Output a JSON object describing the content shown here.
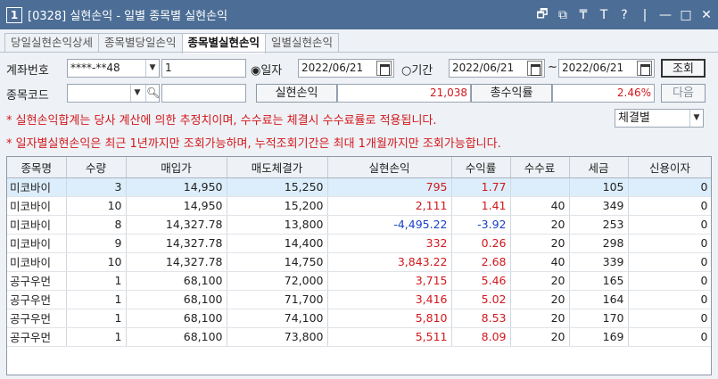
{
  "window": {
    "number": "1",
    "title": "[0328] 실현손익 - 일별 종목별 실현손익",
    "controls": [
      "🗗",
      "⧉",
      "₸",
      "T",
      "?",
      "|",
      "—",
      "□",
      "✕"
    ]
  },
  "tabs": [
    "당일실현손익상세",
    "종목별당일손익",
    "종목별실현손익",
    "일별실현손익"
  ],
  "active_tab": 2,
  "form": {
    "account_label": "계좌번호",
    "account_value": "****-**48",
    "account_sub": "1",
    "radio_date_label": "◉일자",
    "radio_range_label": "○기간",
    "date_value": "2022/06/21",
    "range_start": "2022/06/21",
    "range_sep": "~",
    "range_end": "2022/06/21",
    "query_button": "조회",
    "code_label": "종목코드",
    "code_value": "",
    "realized_label": "실현손익",
    "realized_value": "21,038",
    "total_rate_label": "총수익률",
    "total_rate_value": "2.46%",
    "next_button": "다음",
    "filter_value": "체결별"
  },
  "notes": [
    "* 실현손익합계는 당사 계산에 의한 추정치이며, 수수료는 체결시 수수료률로 적용됩니다.",
    "* 일자별실현손익은 최근 1년까지만 조회가능하며, 누적조회기간은 최대 1개월까지만 조회가능합니다."
  ],
  "table": {
    "headers": [
      "종목명",
      "수량",
      "매입가",
      "매도체결가",
      "실현손익",
      "수익률",
      "수수료",
      "세금",
      "신용이자"
    ],
    "rows": [
      [
        "미코바이",
        "3",
        "14,950",
        "15,250",
        "795",
        "1.77",
        "",
        "105",
        "0"
      ],
      [
        "미코바이",
        "10",
        "14,950",
        "15,200",
        "2,111",
        "1.41",
        "40",
        "349",
        "0"
      ],
      [
        "미코바이",
        "8",
        "14,327.78",
        "13,800",
        "-4,495.22",
        "-3.92",
        "20",
        "253",
        "0"
      ],
      [
        "미코바이",
        "9",
        "14,327.78",
        "14,400",
        "332",
        "0.26",
        "20",
        "298",
        "0"
      ],
      [
        "미코바이",
        "10",
        "14,327.78",
        "14,750",
        "3,843.22",
        "2.68",
        "40",
        "339",
        "0"
      ],
      [
        "공구우먼",
        "1",
        "68,100",
        "72,000",
        "3,715",
        "5.46",
        "20",
        "165",
        "0"
      ],
      [
        "공구우먼",
        "1",
        "68,100",
        "71,700",
        "3,416",
        "5.02",
        "20",
        "164",
        "0"
      ],
      [
        "공구우먼",
        "1",
        "68,100",
        "74,100",
        "5,810",
        "8.53",
        "20",
        "170",
        "0"
      ],
      [
        "공구우먼",
        "1",
        "68,100",
        "73,800",
        "5,511",
        "8.09",
        "20",
        "169",
        "0"
      ]
    ],
    "selected_row": 0
  }
}
